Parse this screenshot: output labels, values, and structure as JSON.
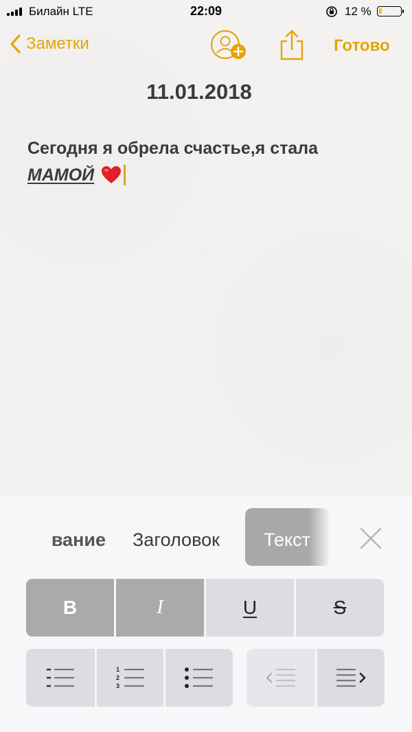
{
  "status_bar": {
    "carrier": "Билайн  LTE",
    "time": "22:09",
    "battery_percent": "12 %",
    "battery_level": 0.12
  },
  "nav": {
    "back_label": "Заметки",
    "done_label": "Готово"
  },
  "note": {
    "date": "11.01.2018",
    "line1": "Сегодня я обрела счастье,я стала",
    "emphasis_word": "МАМОЙ"
  },
  "format_panel": {
    "styles": {
      "cut_label": "вание",
      "heading_label": "Заголовок",
      "text_label": "Текст"
    },
    "buttons": {
      "bold": "B",
      "italic": "I",
      "underline": "U",
      "strikethrough": "S"
    },
    "accent_color": "#e4a30b"
  }
}
